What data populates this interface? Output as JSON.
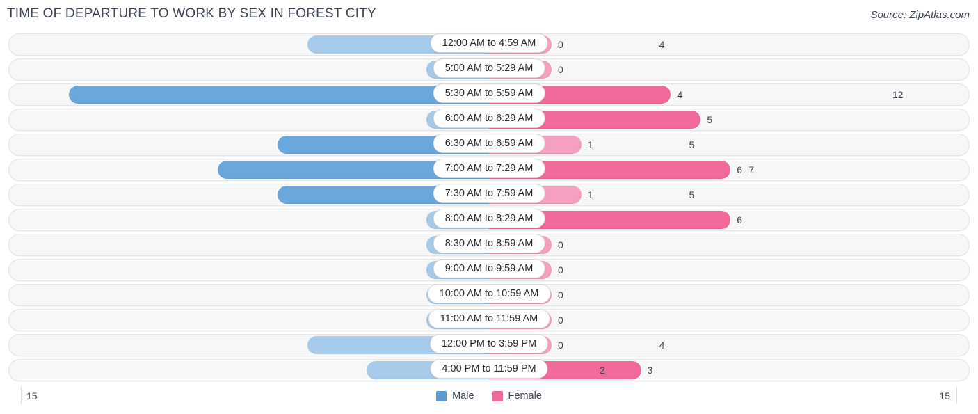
{
  "header": {
    "title": "TIME OF DEPARTURE TO WORK BY SEX IN FOREST CITY",
    "source": "Source: ZipAtlas.com"
  },
  "axis": {
    "left_max": "15",
    "right_max": "15"
  },
  "legend": {
    "items": [
      {
        "label": "Male",
        "color": "#5b9bd5"
      },
      {
        "label": "Female",
        "color": "#f2699c"
      }
    ]
  },
  "colors": {
    "male_light": "#a6cbeb",
    "male_dark": "#6aa7dc",
    "female_light": "#f5a0c0",
    "female_dark": "#f2699c",
    "track": "#f7f7f7",
    "text": "#3d4451"
  },
  "chart_data": {
    "type": "bar",
    "orientation": "horizontal-diverging",
    "title": "TIME OF DEPARTURE TO WORK BY SEX IN FOREST CITY",
    "xlabel": "",
    "ylabel": "",
    "xlim": [
      15,
      15
    ],
    "grid": false,
    "legend_position": "bottom-center",
    "categories": [
      "12:00 AM to 4:59 AM",
      "5:00 AM to 5:29 AM",
      "5:30 AM to 5:59 AM",
      "6:00 AM to 6:29 AM",
      "6:30 AM to 6:59 AM",
      "7:00 AM to 7:29 AM",
      "7:30 AM to 7:59 AM",
      "8:00 AM to 8:29 AM",
      "8:30 AM to 8:59 AM",
      "9:00 AM to 9:59 AM",
      "10:00 AM to 10:59 AM",
      "11:00 AM to 11:59 AM",
      "12:00 PM to 3:59 PM",
      "4:00 PM to 11:59 PM"
    ],
    "series": [
      {
        "name": "Male",
        "values": [
          4,
          0,
          12,
          0,
          5,
          7,
          5,
          0,
          0,
          0,
          0,
          0,
          4,
          2
        ]
      },
      {
        "name": "Female",
        "values": [
          0,
          0,
          4,
          5,
          1,
          6,
          1,
          6,
          0,
          0,
          0,
          0,
          0,
          3
        ]
      }
    ]
  }
}
